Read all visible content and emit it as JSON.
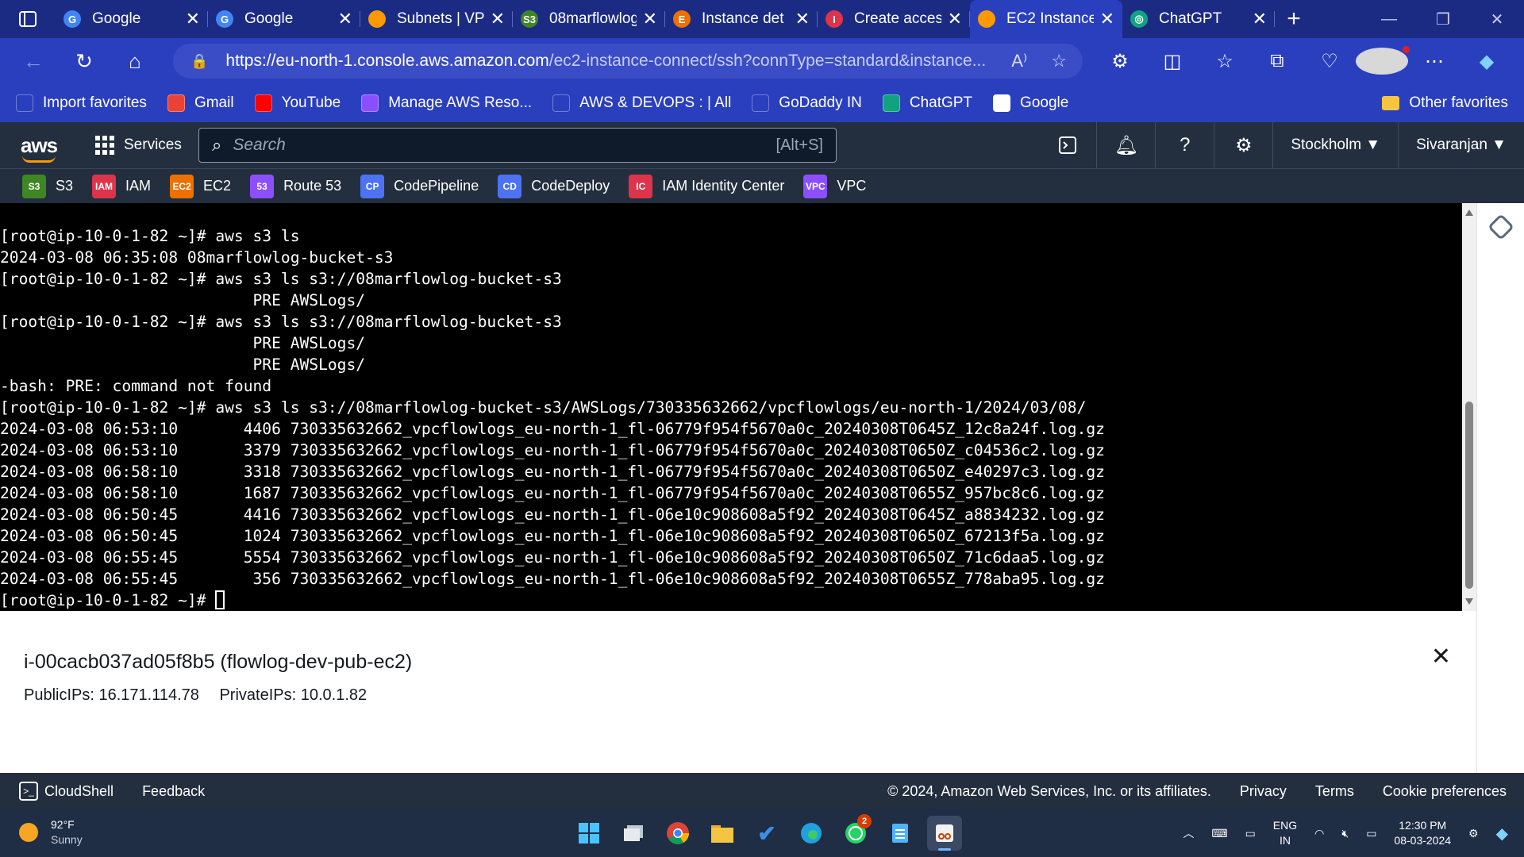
{
  "browser": {
    "tabs": [
      {
        "label": "Google",
        "icon": "google-icon",
        "color": "#4285f4",
        "glyph": "G"
      },
      {
        "label": "Google",
        "icon": "google-icon",
        "color": "#4285f4",
        "glyph": "G"
      },
      {
        "label": "Subnets | VP",
        "icon": "aws-cube-icon",
        "color": "#ff9900",
        "glyph": ""
      },
      {
        "label": "08marflowlog",
        "icon": "s3-bucket-icon",
        "color": "#3f8624",
        "glyph": "S3"
      },
      {
        "label": "Instance det",
        "icon": "ec2-icon",
        "color": "#ed7100",
        "glyph": "E"
      },
      {
        "label": "Create acces",
        "icon": "iam-icon",
        "color": "#dd344c",
        "glyph": "I"
      },
      {
        "label": "EC2 Instance",
        "icon": "aws-cube-icon",
        "color": "#ff9900",
        "glyph": "",
        "active": true
      },
      {
        "label": "ChatGPT",
        "icon": "chatgpt-icon",
        "color": "#10a37f",
        "glyph": "◎"
      }
    ],
    "url_host": "https://eu-north-1.console.aws.amazon.com",
    "url_path": "/ec2-instance-connect/ssh?connType=standard&instance...",
    "favorites": [
      {
        "label": "Import favorites",
        "icon": "import-icon",
        "color": "#2a3fbd"
      },
      {
        "label": "Gmail",
        "icon": "gmail-icon",
        "color": "#ea4335"
      },
      {
        "label": "YouTube",
        "icon": "youtube-icon",
        "color": "#ff0000"
      },
      {
        "label": "Manage AWS Reso...",
        "icon": "aws-resource-icon",
        "color": "#8c4fff"
      },
      {
        "label": "AWS & DEVOPS : | All",
        "icon": "globe-icon",
        "color": "#2a3fbd"
      },
      {
        "label": "GoDaddy IN",
        "icon": "godaddy-icon",
        "color": "#2a3fbd"
      },
      {
        "label": "ChatGPT",
        "icon": "chatgpt-icon",
        "color": "#10a37f"
      },
      {
        "label": "Google",
        "icon": "google-icon",
        "color": "#ffffff"
      }
    ],
    "other_favorites": "Other favorites"
  },
  "aws": {
    "logo": "aws",
    "services_label": "Services",
    "search_placeholder": "Search",
    "search_shortcut": "[Alt+S]",
    "region": "Stockholm",
    "user": "Sivaranjan",
    "shortcuts": [
      {
        "label": "S3",
        "color": "#3f8624",
        "glyph": "S3"
      },
      {
        "label": "IAM",
        "color": "#dd344c",
        "glyph": "IAM"
      },
      {
        "label": "EC2",
        "color": "#ed7100",
        "glyph": "EC2"
      },
      {
        "label": "Route 53",
        "color": "#8c4fff",
        "glyph": "53"
      },
      {
        "label": "CodePipeline",
        "color": "#4d72f3",
        "glyph": "CP"
      },
      {
        "label": "CodeDeploy",
        "color": "#4d72f3",
        "glyph": "CD"
      },
      {
        "label": "IAM Identity Center",
        "color": "#dd344c",
        "glyph": "IC"
      },
      {
        "label": "VPC",
        "color": "#8c4fff",
        "glyph": "VPC"
      }
    ]
  },
  "terminal": {
    "lines": [
      "[root@ip-10-0-1-82 ~]# aws s3 ls",
      "2024-03-08 06:35:08 08marflowlog-bucket-s3",
      "[root@ip-10-0-1-82 ~]# aws s3 ls s3://08marflowlog-bucket-s3",
      "                           PRE AWSLogs/",
      "[root@ip-10-0-1-82 ~]# aws s3 ls s3://08marflowlog-bucket-s3",
      "                           PRE AWSLogs/",
      "                           PRE AWSLogs/",
      "-bash: PRE: command not found",
      "[root@ip-10-0-1-82 ~]# aws s3 ls s3://08marflowlog-bucket-s3/AWSLogs/730335632662/vpcflowlogs/eu-north-1/2024/03/08/",
      "2024-03-08 06:53:10       4406 730335632662_vpcflowlogs_eu-north-1_fl-06779f954f5670a0c_20240308T0645Z_12c8a24f.log.gz",
      "2024-03-08 06:53:10       3379 730335632662_vpcflowlogs_eu-north-1_fl-06779f954f5670a0c_20240308T0650Z_c04536c2.log.gz",
      "2024-03-08 06:58:10       3318 730335632662_vpcflowlogs_eu-north-1_fl-06779f954f5670a0c_20240308T0650Z_e40297c3.log.gz",
      "2024-03-08 06:58:10       1687 730335632662_vpcflowlogs_eu-north-1_fl-06779f954f5670a0c_20240308T0655Z_957bc8c6.log.gz",
      "2024-03-08 06:50:45       4416 730335632662_vpcflowlogs_eu-north-1_fl-06e10c908608a5f92_20240308T0645Z_a8834232.log.gz",
      "2024-03-08 06:50:45       1024 730335632662_vpcflowlogs_eu-north-1_fl-06e10c908608a5f92_20240308T0650Z_67213f5a.log.gz",
      "2024-03-08 06:55:45       5554 730335632662_vpcflowlogs_eu-north-1_fl-06e10c908608a5f92_20240308T0650Z_71c6daa5.log.gz",
      "2024-03-08 06:55:45        356 730335632662_vpcflowlogs_eu-north-1_fl-06e10c908608a5f92_20240308T0655Z_778aba95.log.gz"
    ],
    "prompt": "[root@ip-10-0-1-82 ~]# "
  },
  "instance": {
    "title": "i-00cacb037ad05f8b5 (flowlog-dev-pub-ec2)",
    "public_ips": "PublicIPs: 16.171.114.78",
    "private_ips": "PrivateIPs: 10.0.1.82"
  },
  "footer": {
    "cloudshell": "CloudShell",
    "feedback": "Feedback",
    "copyright": "© 2024, Amazon Web Services, Inc. or its affiliates.",
    "privacy": "Privacy",
    "terms": "Terms",
    "cookies": "Cookie preferences"
  },
  "taskbar": {
    "temp": "92°F",
    "condition": "Sunny",
    "lang1": "ENG",
    "lang2": "IN",
    "time": "12:30 PM",
    "date": "08-03-2024",
    "whatsapp_badge": "2"
  }
}
